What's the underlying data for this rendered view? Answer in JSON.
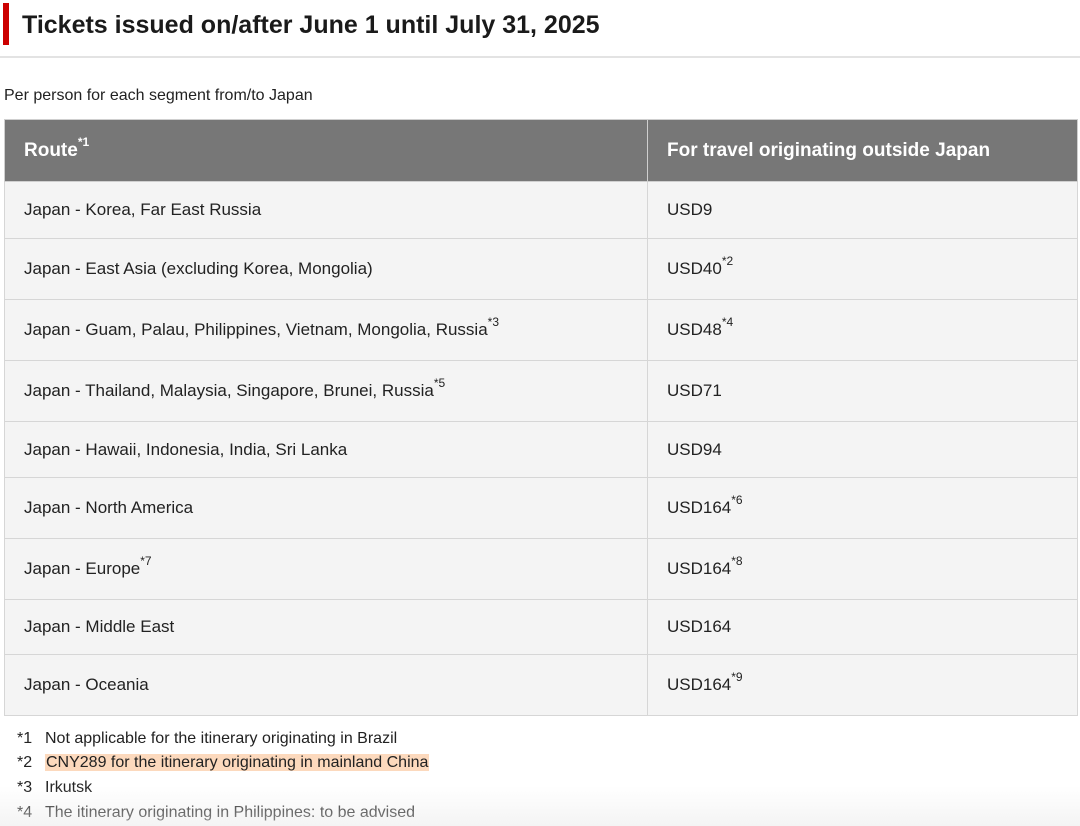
{
  "heading": {
    "title": "Tickets issued on/after June 1 until July 31, 2025",
    "accent_color": "#cc0000"
  },
  "subtitle": "Per person for each segment from/to Japan",
  "table": {
    "header_bg": "#777777",
    "columns": [
      {
        "label": "Route",
        "sup": "*1"
      },
      {
        "label": "For travel originating outside Japan",
        "sup": ""
      }
    ],
    "rows": [
      {
        "route": "Japan - Korea, Far East Russia",
        "route_sup": "",
        "fare": "USD9",
        "fare_sup": ""
      },
      {
        "route": "Japan - East Asia (excluding Korea, Mongolia)",
        "route_sup": "",
        "fare": "USD40",
        "fare_sup": "*2"
      },
      {
        "route": "Japan - Guam, Palau, Philippines, Vietnam, Mongolia, Russia",
        "route_sup": "*3",
        "fare": "USD48",
        "fare_sup": "*4"
      },
      {
        "route": "Japan - Thailand, Malaysia, Singapore, Brunei, Russia",
        "route_sup": "*5",
        "fare": "USD71",
        "fare_sup": ""
      },
      {
        "route": "Japan - Hawaii, Indonesia, India, Sri Lanka",
        "route_sup": "",
        "fare": "USD94",
        "fare_sup": ""
      },
      {
        "route": "Japan - North America",
        "route_sup": "",
        "fare": "USD164",
        "fare_sup": "*6"
      },
      {
        "route": "Japan - Europe",
        "route_sup": "*7",
        "fare": "USD164",
        "fare_sup": "*8"
      },
      {
        "route": "Japan - Middle East",
        "route_sup": "",
        "fare": "USD164",
        "fare_sup": ""
      },
      {
        "route": "Japan - Oceania",
        "route_sup": "",
        "fare": "USD164",
        "fare_sup": "*9"
      }
    ]
  },
  "notes": [
    {
      "mark": "*1",
      "text": "Not applicable for the itinerary originating in Brazil",
      "highlighted": false
    },
    {
      "mark": "*2",
      "text": "CNY289 for the itinerary originating in mainland China",
      "highlighted": true
    },
    {
      "mark": "*3",
      "text": "Irkutsk",
      "highlighted": false
    },
    {
      "mark": "*4",
      "text": "The itinerary originating in Philippines: to be advised",
      "highlighted": false
    }
  ],
  "highlight_color": "#fcd9bd"
}
